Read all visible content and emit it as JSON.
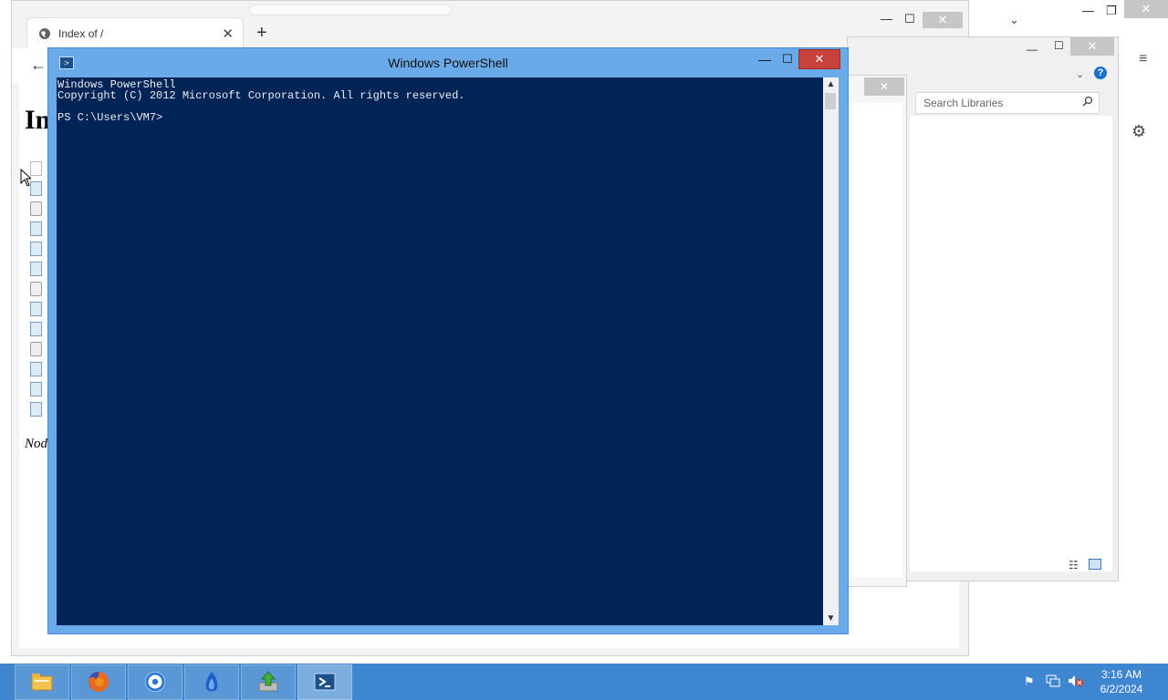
{
  "browser": {
    "tab_title": "Index of /",
    "tab_close": "✕",
    "new_tab": "+",
    "back": "←",
    "heading": "In",
    "footer": "Nod",
    "min": "—",
    "max": "☐",
    "close": "✕"
  },
  "outer": {
    "min": "—",
    "max": "❐",
    "close": "✕",
    "chevron": "⌄",
    "menu": "≡",
    "settings": "⚙"
  },
  "libraries": {
    "search_placeholder": "Search Libraries",
    "min": "—",
    "max": "☐",
    "close": "✕",
    "help": "?",
    "chevron": "⌄"
  },
  "win3": {
    "close": "✕"
  },
  "powershell": {
    "title": "Windows PowerShell",
    "min": "—",
    "max": "☐",
    "close": "✕",
    "console_text": "Windows PowerShell\nCopyright (C) 2012 Microsoft Corporation. All rights reserved.\n\nPS C:\\Users\\VM7>",
    "scroll_up": "▲",
    "scroll_down": "▼"
  },
  "taskbar": {
    "apps": [
      {
        "name": "File Explorer",
        "icon": "folder-icon",
        "color": "#f2c14e"
      },
      {
        "name": "Firefox",
        "icon": "firefox-icon",
        "color": "#e66a1f"
      },
      {
        "name": "Chrome",
        "icon": "chrome-icon",
        "color": "#2a78d6"
      },
      {
        "name": "App",
        "icon": "blue-flame-icon",
        "color": "#1d5fc7"
      },
      {
        "name": "Installer",
        "icon": "green-arrow-icon",
        "color": "#3fae3a"
      },
      {
        "name": "Windows PowerShell",
        "icon": "powershell-icon",
        "color": "#1c4f8c"
      }
    ],
    "time": "3:16 AM",
    "date": "6/2/2024"
  },
  "colors": {
    "console_bg": "#012456",
    "console_fg": "#eeedf0",
    "ps_frame": "#6aaae8",
    "ps_close": "#c7423b",
    "taskbar": "#3f86d0"
  }
}
